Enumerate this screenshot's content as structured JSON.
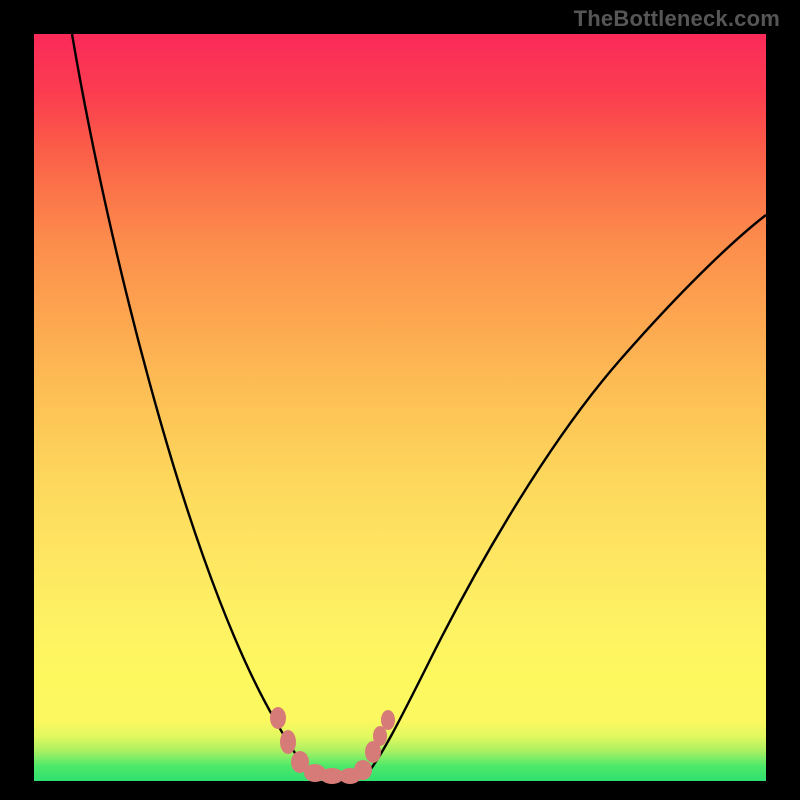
{
  "attribution": "TheBottleneck.com",
  "chart_data": {
    "type": "line",
    "title": "",
    "xlabel": "",
    "ylabel": "",
    "xlim": [
      0,
      100
    ],
    "ylim": [
      0,
      100
    ],
    "grid": false,
    "legend": false,
    "series": [
      {
        "name": "left-curve",
        "x": [
          5,
          8,
          12,
          16,
          20,
          24,
          28,
          31,
          33,
          35,
          37,
          38
        ],
        "values": [
          100,
          85,
          68,
          53,
          40,
          28,
          18,
          10,
          5,
          2,
          0.5,
          0
        ]
      },
      {
        "name": "right-curve",
        "x": [
          44,
          46,
          50,
          55,
          62,
          70,
          78,
          86,
          94,
          100
        ],
        "values": [
          0,
          2,
          8,
          17,
          29,
          41,
          51,
          60,
          67,
          72
        ]
      },
      {
        "name": "markers",
        "x": [
          33,
          35,
          36,
          37,
          38,
          40,
          42,
          43,
          44,
          45,
          46
        ],
        "values": [
          8,
          4,
          2,
          0.8,
          0,
          0,
          0,
          0.5,
          2,
          4,
          8
        ]
      }
    ],
    "gradient_stops": [
      {
        "pos": 0,
        "color": "#2fe06f"
      },
      {
        "pos": 8,
        "color": "#fbf860"
      },
      {
        "pos": 40,
        "color": "#fdd85c"
      },
      {
        "pos": 72,
        "color": "#fc8d4c"
      },
      {
        "pos": 100,
        "color": "#fb2a59"
      }
    ],
    "marker_color": "#d77b78"
  }
}
